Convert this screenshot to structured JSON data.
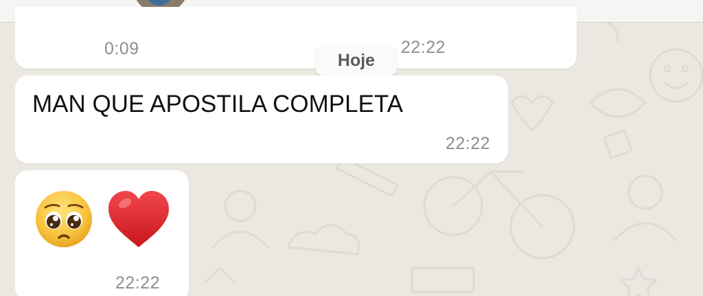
{
  "chat": {
    "messages": [
      {
        "type": "audio",
        "duration": "0:09",
        "time": "22:22"
      },
      {
        "type": "text",
        "text": "MAN QUE APOSTILA COMPLETA",
        "time": "22:22"
      },
      {
        "type": "emoji",
        "emojis": [
          "pleading-face",
          "red-heart"
        ],
        "time": "22:22"
      }
    ],
    "date_separator": "Hoje"
  },
  "colors": {
    "wallpaper": "#ebe7e1",
    "bubble": "#ffffff",
    "timestamp": "#8e8e8e",
    "heart": "#e0282e",
    "pleading_face": "#f7c23d"
  }
}
